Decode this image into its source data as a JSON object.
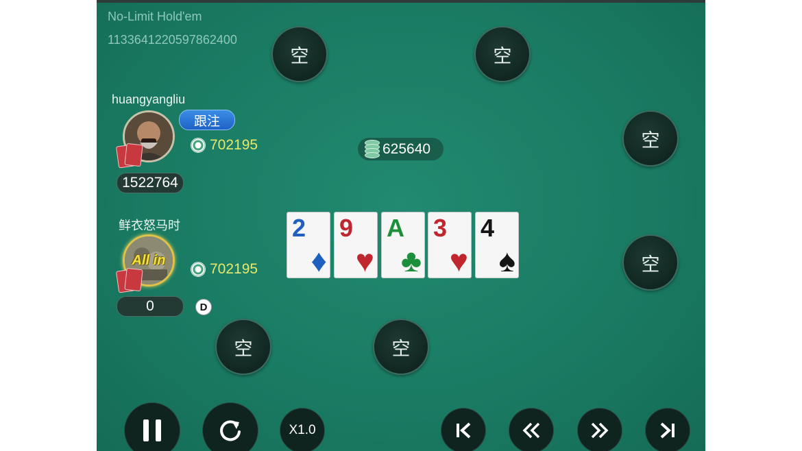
{
  "game": {
    "title": "No-Limit Hold'em",
    "id": "1133641220597862400"
  },
  "empty_seat_label": "空",
  "players": [
    {
      "name": "huangyangliu",
      "bet": "702195",
      "stack": "1522764",
      "action": "跟注"
    },
    {
      "name": "鲜衣怒马时",
      "bet": "702195",
      "stack": "0",
      "status": "All in",
      "dealer": "D"
    }
  ],
  "pot": "625640",
  "board": [
    {
      "rank": "2",
      "suit": "♦",
      "color": "#1f5fbf"
    },
    {
      "rank": "9",
      "suit": "♥",
      "color": "#c0262d"
    },
    {
      "rank": "A",
      "suit": "♣",
      "color": "#1c8f3a"
    },
    {
      "rank": "3",
      "suit": "♥",
      "color": "#c0262d"
    },
    {
      "rank": "4",
      "suit": "♠",
      "color": "#151515"
    }
  ],
  "controls": {
    "speed": "X1.0",
    "icons": [
      "pause-icon",
      "replay-icon",
      "skip-to-start-icon",
      "rewind-icon",
      "fast-forward-icon",
      "skip-to-end-icon"
    ]
  },
  "colors": {
    "felt": "#1a7b63",
    "bet_text": "#e8e86a",
    "action_badge": "#2a74d8"
  }
}
